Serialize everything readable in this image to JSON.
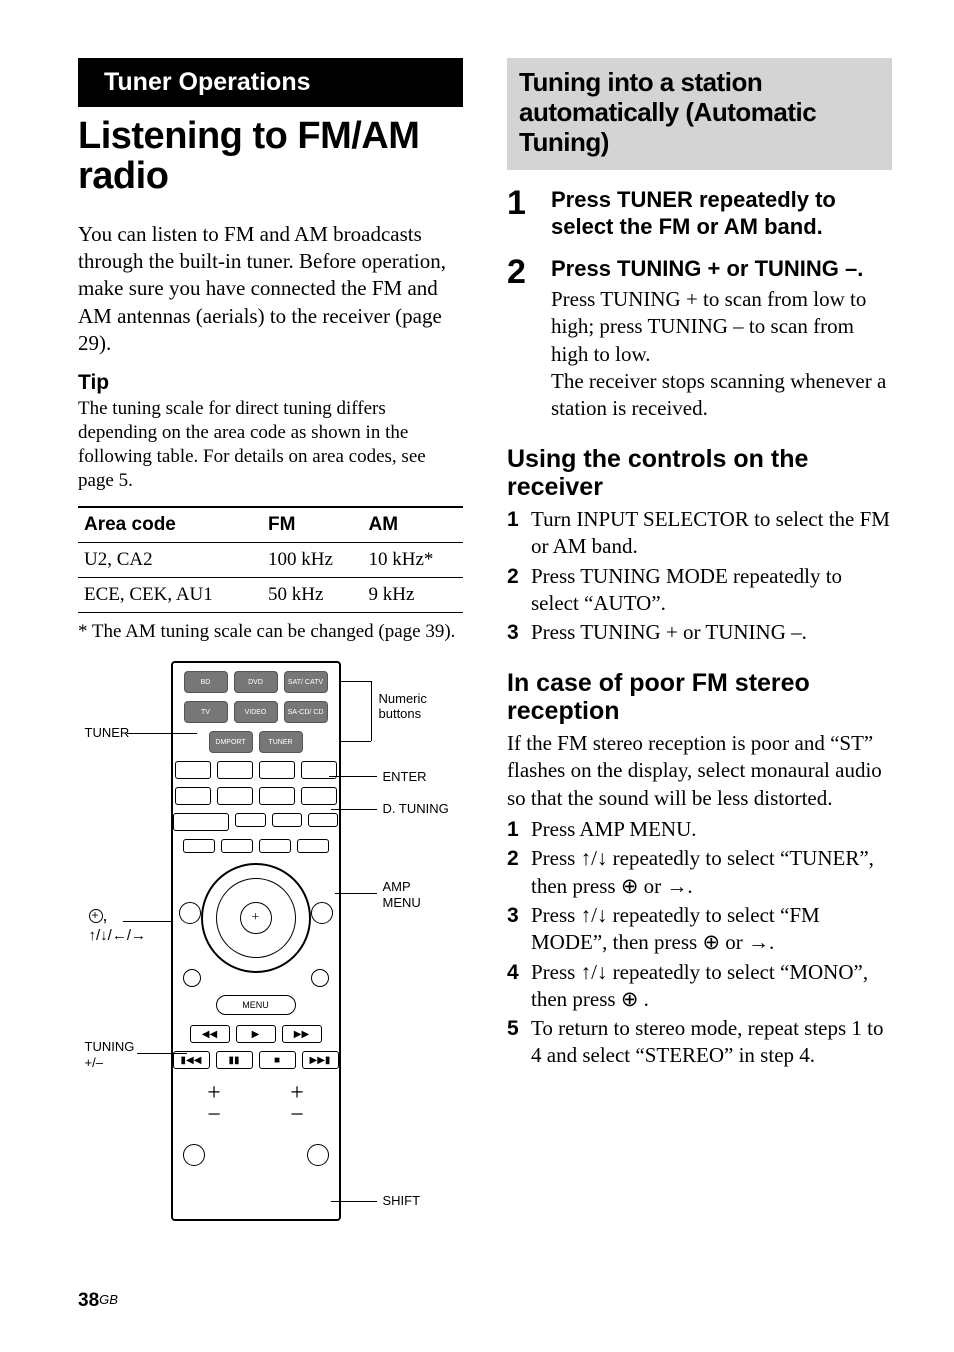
{
  "left": {
    "section_tab": "Tuner Operations",
    "title": "Listening to FM/AM radio",
    "intro": "You can listen to FM and AM broadcasts through the built-in tuner. Before operation, make sure you have connected the FM and AM antennas (aerials) to the receiver (page 29).",
    "tip_label": "Tip",
    "tip_body": "The tuning scale for direct tuning differs depending on the area code as shown in the following table. For details on area codes, see page 5.",
    "table": {
      "headers": [
        "Area code",
        "FM",
        "AM"
      ],
      "rows": [
        [
          "U2, CA2",
          "100 kHz",
          "10 kHz*"
        ],
        [
          "ECE, CEK, AU1",
          "50 kHz",
          "9 kHz"
        ]
      ]
    },
    "footnote": "* The AM tuning scale can be changed (page 39).",
    "remote": {
      "labels": {
        "tuner": "TUNER",
        "numeric": "Numeric buttons",
        "enter": "ENTER",
        "dtuning": "D. TUNING",
        "ampmenu_a": "AMP",
        "ampmenu_b": "MENU",
        "navglyph": ",",
        "tuning_a": "TUNING",
        "tuning_b": "+/–",
        "shift": "SHIFT"
      },
      "row1": [
        "BD",
        "DVD",
        "SAT/\nCATV"
      ],
      "row2": [
        "TV",
        "VIDEO",
        "SA-CD/\nCD"
      ],
      "row3": [
        "DMPORT",
        "TUNER"
      ],
      "menu_pill": "MENU"
    }
  },
  "right": {
    "box_title": "Tuning into a station automatically (Automatic Tuning)",
    "steps_big": [
      {
        "n": "1",
        "head": "Press TUNER repeatedly to select the FM or AM band."
      },
      {
        "n": "2",
        "head": "Press TUNING + or TUNING –.",
        "body": "Press TUNING + to scan from low to high; press TUNING – to scan from high to low.\nThe receiver stops scanning whenever a station is received."
      }
    ],
    "sub1": {
      "title": "Using the controls on the receiver",
      "items": [
        {
          "n": "1",
          "t": "Turn INPUT SELECTOR to select the FM or AM band."
        },
        {
          "n": "2",
          "t": "Press TUNING MODE repeatedly to select “AUTO”."
        },
        {
          "n": "3",
          "t": "Press TUNING + or TUNING –."
        }
      ]
    },
    "sub2": {
      "title": "In case of poor FM stereo reception",
      "intro": "If the FM stereo reception is poor and “ST” flashes on the display, select monaural audio so that the sound will be less distorted.",
      "items": [
        {
          "n": "1",
          "t": "Press AMP MENU."
        },
        {
          "n": "2",
          "t": "Press ↑/↓ repeatedly to select “TUNER”, then press ⊕ or →."
        },
        {
          "n": "3",
          "t": "Press ↑/↓ repeatedly to select “FM MODE”, then press ⊕ or →."
        },
        {
          "n": "4",
          "t": "Press ↑/↓ repeatedly to select “MONO”, then press ⊕ ."
        },
        {
          "n": "5",
          "t": "To return to stereo mode, repeat steps 1 to 4 and select “STEREO” in step 4."
        }
      ]
    }
  },
  "footer": {
    "page": "38",
    "suffix": "GB"
  }
}
